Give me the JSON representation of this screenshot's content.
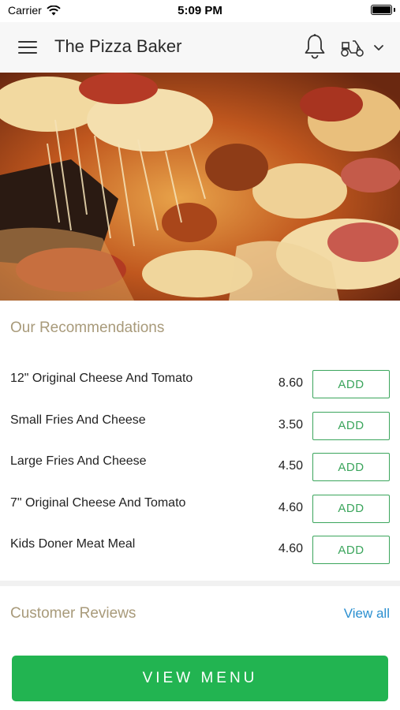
{
  "status": {
    "carrier": "Carrier",
    "time": "5:09 PM"
  },
  "header": {
    "title": "The Pizza Baker"
  },
  "recommendations": {
    "title": "Our Recommendations",
    "items": [
      {
        "name": "12\" Original Cheese And Tomato",
        "price": "8.60",
        "action": "ADD"
      },
      {
        "name": "Small Fries And Cheese",
        "price": "3.50",
        "action": "ADD"
      },
      {
        "name": "Large Fries And Cheese",
        "price": "4.50",
        "action": "ADD"
      },
      {
        "name": "7\" Original Cheese And Tomato",
        "price": "4.60",
        "action": "ADD"
      },
      {
        "name": "Kids Doner Meat Meal",
        "price": "4.60",
        "action": "ADD"
      }
    ]
  },
  "reviews": {
    "title": "Customer Reviews",
    "view_all": "View all"
  },
  "footer": {
    "view_menu": "VIEW MENU"
  },
  "colors": {
    "accent_green": "#22b451",
    "add_green": "#3ba55c",
    "link_blue": "#2a8fd0",
    "section_title": "#a89a7a"
  }
}
